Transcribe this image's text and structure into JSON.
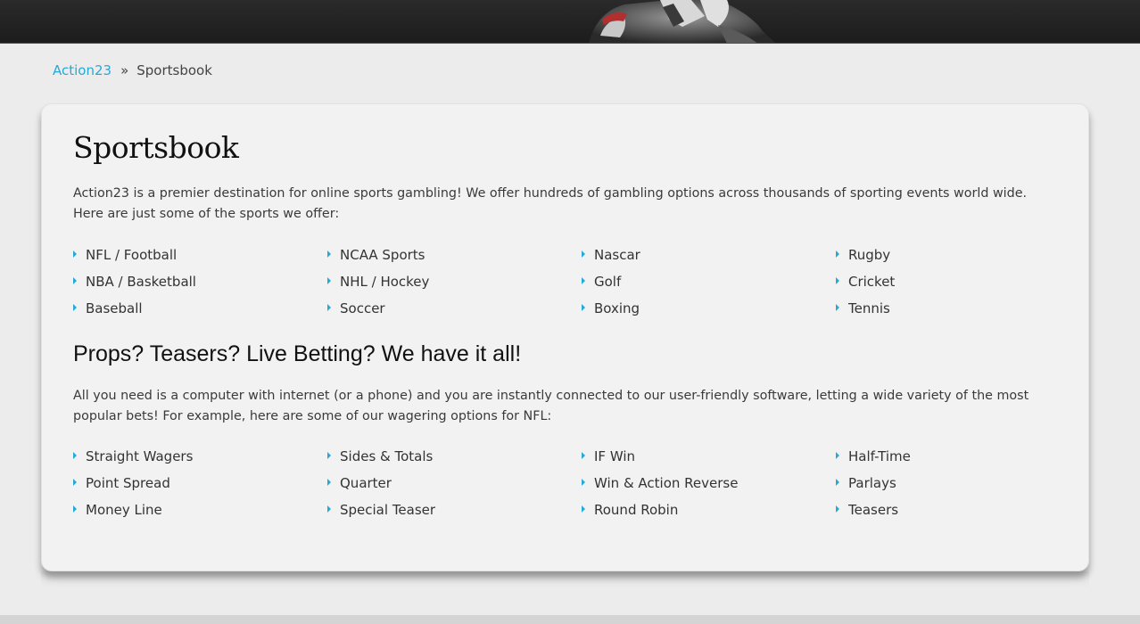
{
  "breadcrumb": {
    "home": "Action23",
    "separator": "»",
    "current": "Sportsbook"
  },
  "page": {
    "title": "Sportsbook",
    "intro": "Action23 is a premier destination for online sports gambling! We offer hundreds of gambling options across thousands of sporting events world wide. Here are just some of the sports we offer:",
    "sports": [
      "NFL / Football",
      "NBA / Basketball",
      "Baseball",
      "NCAA Sports",
      "NHL / Hockey",
      "Soccer",
      "Nascar",
      "Golf",
      "Boxing",
      "Rugby",
      "Cricket",
      "Tennis"
    ],
    "subtitle": "Props? Teasers? Live Betting? We have it all!",
    "intro2": "All you need is a computer with internet (or a phone) and you are instantly connected to our user-friendly software, letting a wide variety of the most popular bets! For example, here are some of our wagering options for NFL:",
    "wagers": [
      "Straight Wagers",
      "Point Spread",
      "Money Line",
      "Sides & Totals",
      "Quarter",
      "Special Teaser",
      "IF Win",
      "Win & Action Reverse",
      "Round Robin",
      "Half-Time",
      "Parlays",
      "Teasers"
    ]
  },
  "colors": {
    "accent": "#27a9d8",
    "hero": "#1c1c1c",
    "card": "#f2f2f2"
  }
}
